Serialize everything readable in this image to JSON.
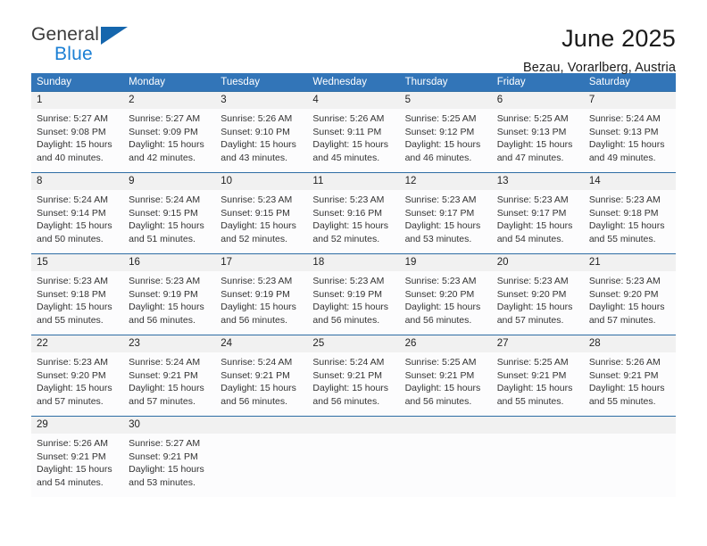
{
  "logo": {
    "primary_text": "General",
    "secondary_text": "Blue",
    "primary_color": "#3b3b3b",
    "secondary_color": "#1b7fd4",
    "triangle_color": "#1566ad"
  },
  "header": {
    "title": "June 2025",
    "subtitle": "Bezau, Vorarlberg, Austria"
  },
  "theme": {
    "header_blue": "#3275b8",
    "row_divider_blue": "#2e6da4",
    "daynum_band": "#f1f1f1"
  },
  "weekdays": [
    "Sunday",
    "Monday",
    "Tuesday",
    "Wednesday",
    "Thursday",
    "Friday",
    "Saturday"
  ],
  "weeks": [
    [
      {
        "day": "1",
        "sunrise": "Sunrise: 5:27 AM",
        "sunset": "Sunset: 9:08 PM",
        "daylight_line1": "Daylight: 15 hours",
        "daylight_line2": "and 40 minutes."
      },
      {
        "day": "2",
        "sunrise": "Sunrise: 5:27 AM",
        "sunset": "Sunset: 9:09 PM",
        "daylight_line1": "Daylight: 15 hours",
        "daylight_line2": "and 42 minutes."
      },
      {
        "day": "3",
        "sunrise": "Sunrise: 5:26 AM",
        "sunset": "Sunset: 9:10 PM",
        "daylight_line1": "Daylight: 15 hours",
        "daylight_line2": "and 43 minutes."
      },
      {
        "day": "4",
        "sunrise": "Sunrise: 5:26 AM",
        "sunset": "Sunset: 9:11 PM",
        "daylight_line1": "Daylight: 15 hours",
        "daylight_line2": "and 45 minutes."
      },
      {
        "day": "5",
        "sunrise": "Sunrise: 5:25 AM",
        "sunset": "Sunset: 9:12 PM",
        "daylight_line1": "Daylight: 15 hours",
        "daylight_line2": "and 46 minutes."
      },
      {
        "day": "6",
        "sunrise": "Sunrise: 5:25 AM",
        "sunset": "Sunset: 9:13 PM",
        "daylight_line1": "Daylight: 15 hours",
        "daylight_line2": "and 47 minutes."
      },
      {
        "day": "7",
        "sunrise": "Sunrise: 5:24 AM",
        "sunset": "Sunset: 9:13 PM",
        "daylight_line1": "Daylight: 15 hours",
        "daylight_line2": "and 49 minutes."
      }
    ],
    [
      {
        "day": "8",
        "sunrise": "Sunrise: 5:24 AM",
        "sunset": "Sunset: 9:14 PM",
        "daylight_line1": "Daylight: 15 hours",
        "daylight_line2": "and 50 minutes."
      },
      {
        "day": "9",
        "sunrise": "Sunrise: 5:24 AM",
        "sunset": "Sunset: 9:15 PM",
        "daylight_line1": "Daylight: 15 hours",
        "daylight_line2": "and 51 minutes."
      },
      {
        "day": "10",
        "sunrise": "Sunrise: 5:23 AM",
        "sunset": "Sunset: 9:15 PM",
        "daylight_line1": "Daylight: 15 hours",
        "daylight_line2": "and 52 minutes."
      },
      {
        "day": "11",
        "sunrise": "Sunrise: 5:23 AM",
        "sunset": "Sunset: 9:16 PM",
        "daylight_line1": "Daylight: 15 hours",
        "daylight_line2": "and 52 minutes."
      },
      {
        "day": "12",
        "sunrise": "Sunrise: 5:23 AM",
        "sunset": "Sunset: 9:17 PM",
        "daylight_line1": "Daylight: 15 hours",
        "daylight_line2": "and 53 minutes."
      },
      {
        "day": "13",
        "sunrise": "Sunrise: 5:23 AM",
        "sunset": "Sunset: 9:17 PM",
        "daylight_line1": "Daylight: 15 hours",
        "daylight_line2": "and 54 minutes."
      },
      {
        "day": "14",
        "sunrise": "Sunrise: 5:23 AM",
        "sunset": "Sunset: 9:18 PM",
        "daylight_line1": "Daylight: 15 hours",
        "daylight_line2": "and 55 minutes."
      }
    ],
    [
      {
        "day": "15",
        "sunrise": "Sunrise: 5:23 AM",
        "sunset": "Sunset: 9:18 PM",
        "daylight_line1": "Daylight: 15 hours",
        "daylight_line2": "and 55 minutes."
      },
      {
        "day": "16",
        "sunrise": "Sunrise: 5:23 AM",
        "sunset": "Sunset: 9:19 PM",
        "daylight_line1": "Daylight: 15 hours",
        "daylight_line2": "and 56 minutes."
      },
      {
        "day": "17",
        "sunrise": "Sunrise: 5:23 AM",
        "sunset": "Sunset: 9:19 PM",
        "daylight_line1": "Daylight: 15 hours",
        "daylight_line2": "and 56 minutes."
      },
      {
        "day": "18",
        "sunrise": "Sunrise: 5:23 AM",
        "sunset": "Sunset: 9:19 PM",
        "daylight_line1": "Daylight: 15 hours",
        "daylight_line2": "and 56 minutes."
      },
      {
        "day": "19",
        "sunrise": "Sunrise: 5:23 AM",
        "sunset": "Sunset: 9:20 PM",
        "daylight_line1": "Daylight: 15 hours",
        "daylight_line2": "and 56 minutes."
      },
      {
        "day": "20",
        "sunrise": "Sunrise: 5:23 AM",
        "sunset": "Sunset: 9:20 PM",
        "daylight_line1": "Daylight: 15 hours",
        "daylight_line2": "and 57 minutes."
      },
      {
        "day": "21",
        "sunrise": "Sunrise: 5:23 AM",
        "sunset": "Sunset: 9:20 PM",
        "daylight_line1": "Daylight: 15 hours",
        "daylight_line2": "and 57 minutes."
      }
    ],
    [
      {
        "day": "22",
        "sunrise": "Sunrise: 5:23 AM",
        "sunset": "Sunset: 9:20 PM",
        "daylight_line1": "Daylight: 15 hours",
        "daylight_line2": "and 57 minutes."
      },
      {
        "day": "23",
        "sunrise": "Sunrise: 5:24 AM",
        "sunset": "Sunset: 9:21 PM",
        "daylight_line1": "Daylight: 15 hours",
        "daylight_line2": "and 57 minutes."
      },
      {
        "day": "24",
        "sunrise": "Sunrise: 5:24 AM",
        "sunset": "Sunset: 9:21 PM",
        "daylight_line1": "Daylight: 15 hours",
        "daylight_line2": "and 56 minutes."
      },
      {
        "day": "25",
        "sunrise": "Sunrise: 5:24 AM",
        "sunset": "Sunset: 9:21 PM",
        "daylight_line1": "Daylight: 15 hours",
        "daylight_line2": "and 56 minutes."
      },
      {
        "day": "26",
        "sunrise": "Sunrise: 5:25 AM",
        "sunset": "Sunset: 9:21 PM",
        "daylight_line1": "Daylight: 15 hours",
        "daylight_line2": "and 56 minutes."
      },
      {
        "day": "27",
        "sunrise": "Sunrise: 5:25 AM",
        "sunset": "Sunset: 9:21 PM",
        "daylight_line1": "Daylight: 15 hours",
        "daylight_line2": "and 55 minutes."
      },
      {
        "day": "28",
        "sunrise": "Sunrise: 5:26 AM",
        "sunset": "Sunset: 9:21 PM",
        "daylight_line1": "Daylight: 15 hours",
        "daylight_line2": "and 55 minutes."
      }
    ],
    [
      {
        "day": "29",
        "sunrise": "Sunrise: 5:26 AM",
        "sunset": "Sunset: 9:21 PM",
        "daylight_line1": "Daylight: 15 hours",
        "daylight_line2": "and 54 minutes."
      },
      {
        "day": "30",
        "sunrise": "Sunrise: 5:27 AM",
        "sunset": "Sunset: 9:21 PM",
        "daylight_line1": "Daylight: 15 hours",
        "daylight_line2": "and 53 minutes."
      },
      {
        "day": "",
        "sunrise": "",
        "sunset": "",
        "daylight_line1": "",
        "daylight_line2": ""
      },
      {
        "day": "",
        "sunrise": "",
        "sunset": "",
        "daylight_line1": "",
        "daylight_line2": ""
      },
      {
        "day": "",
        "sunrise": "",
        "sunset": "",
        "daylight_line1": "",
        "daylight_line2": ""
      },
      {
        "day": "",
        "sunrise": "",
        "sunset": "",
        "daylight_line1": "",
        "daylight_line2": ""
      },
      {
        "day": "",
        "sunrise": "",
        "sunset": "",
        "daylight_line1": "",
        "daylight_line2": ""
      }
    ]
  ]
}
